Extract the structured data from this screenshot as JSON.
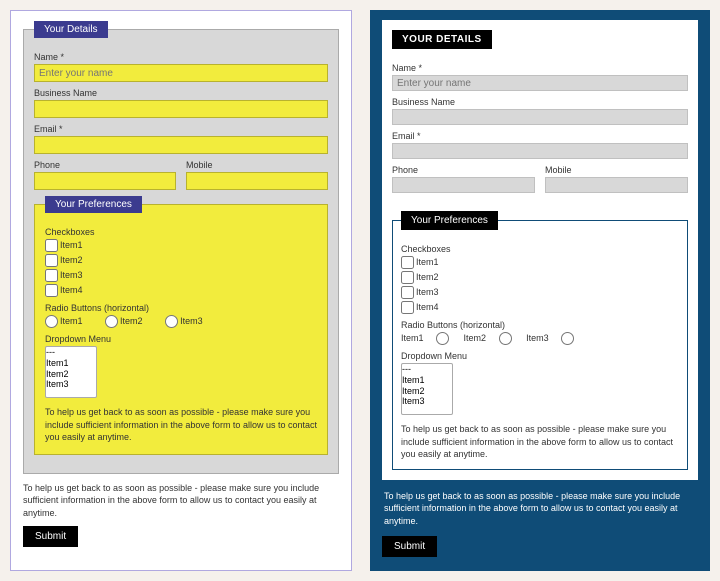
{
  "help_text": "To help us get back to as soon as possible - please make sure you include sufficient information in the above form to allow us to contact you easily at anytime.",
  "submit_label": "Submit",
  "details": {
    "title_left": "Your Details",
    "title_right": "YOUR DETAILS",
    "name_label": "Name *",
    "name_placeholder": "Enter your name",
    "business_label": "Business Name",
    "email_label": "Email *",
    "phone_label": "Phone",
    "mobile_label": "Mobile"
  },
  "prefs": {
    "title": "Your Preferences",
    "checkboxes_label": "Checkboxes",
    "items": [
      "Item1",
      "Item2",
      "Item3",
      "Item4"
    ],
    "radio_label": "Radio Buttons (horizontal)",
    "radios": [
      "Item1",
      "Item2",
      "Item3"
    ],
    "dropdown_label": "Dropdown Menu",
    "dropdown_options": [
      "---",
      "Item1",
      "Item2",
      "Item3"
    ]
  }
}
